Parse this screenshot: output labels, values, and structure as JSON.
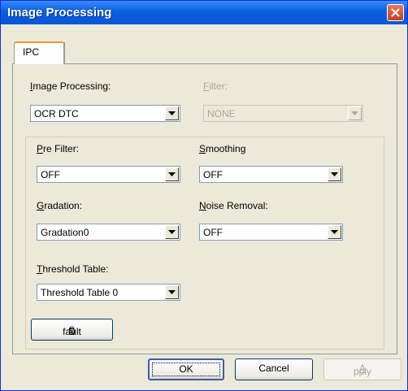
{
  "window": {
    "title": "Image Processing"
  },
  "tabs": [
    {
      "label": "IPC"
    }
  ],
  "image_processing": {
    "label_pre": "",
    "label_ul": "I",
    "label_post": "mage Processing:",
    "value": "OCR DTC"
  },
  "filter": {
    "label_pre": "",
    "label_ul": "F",
    "label_post": "ilter:",
    "value": "NONE"
  },
  "pre_filter": {
    "label_pre": "",
    "label_ul": "P",
    "label_post": "re Filter:",
    "value": "OFF"
  },
  "smoothing": {
    "label_pre": "",
    "label_ul": "S",
    "label_post": "moothing",
    "value": "OFF"
  },
  "gradation": {
    "label_pre": "",
    "label_ul": "G",
    "label_post": "radation:",
    "value": "Gradation0"
  },
  "noise_removal": {
    "label_pre": "",
    "label_ul": "N",
    "label_post": "oise Removal:",
    "value": "OFF"
  },
  "threshold_table": {
    "label_pre": "",
    "label_ul": "T",
    "label_post": "hreshold Table:",
    "value": "Threshold Table 0"
  },
  "default_button": {
    "label_pre": "D",
    "label_ul": "e",
    "label_post": "fault"
  },
  "buttons": {
    "ok": "OK",
    "cancel": "Cancel",
    "apply_pre": "",
    "apply_ul": "A",
    "apply_post": "pply"
  }
}
